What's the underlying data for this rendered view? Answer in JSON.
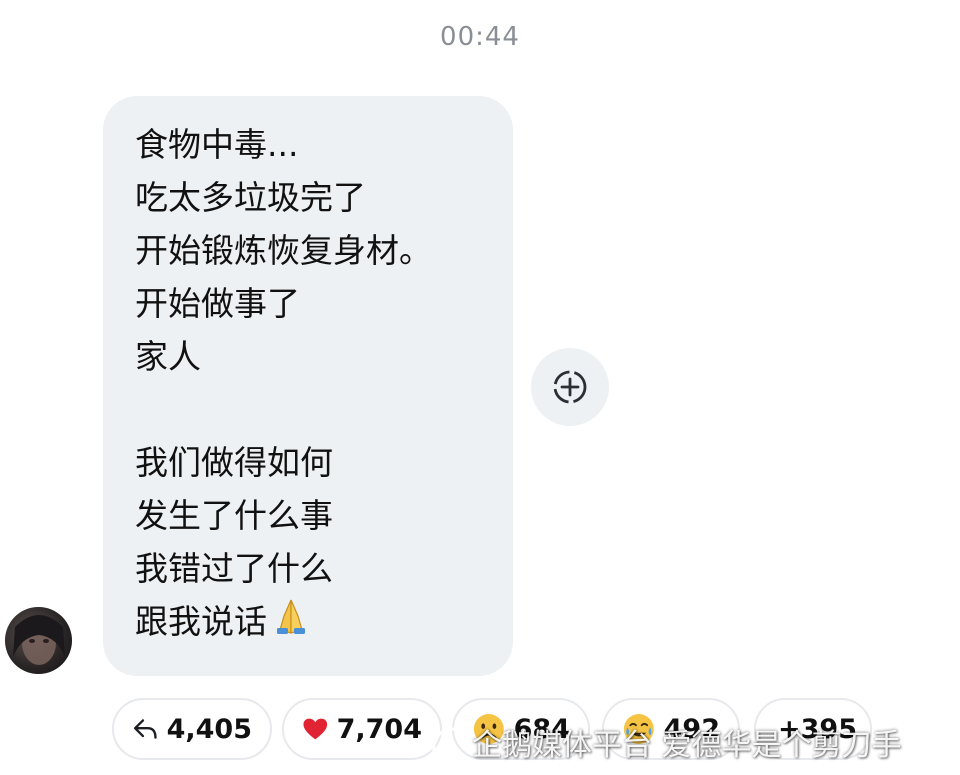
{
  "timestamp": "00:44",
  "message": {
    "lines": [
      "食物中毒...",
      "吃太多垃圾完了",
      "开始锻炼恢复身材。",
      "开始做事了",
      "家人",
      "",
      "我们做得如何",
      "发生了什么事",
      "我错过了什么",
      "跟我说话"
    ],
    "trailing_emoji": "folded-hands"
  },
  "add_reaction_icon": "add-reaction-icon",
  "avatar": "profile-avatar",
  "reactions": [
    {
      "icon": "reply-arrow-icon",
      "count": "4,405"
    },
    {
      "icon": "red-heart-emoji",
      "count": "7,704"
    },
    {
      "icon": "sad-face-emoji",
      "count": "684"
    },
    {
      "icon": "crying-face-emoji",
      "count": "492"
    },
    {
      "icon": "",
      "count": "+395"
    }
  ],
  "watermark": {
    "text": "企鹅媒体平台 爱德华是个剪刀手"
  },
  "colors": {
    "bubble": "#eef1f3",
    "timestamp": "#8a8f96",
    "chip_border": "#e7e9ec"
  }
}
